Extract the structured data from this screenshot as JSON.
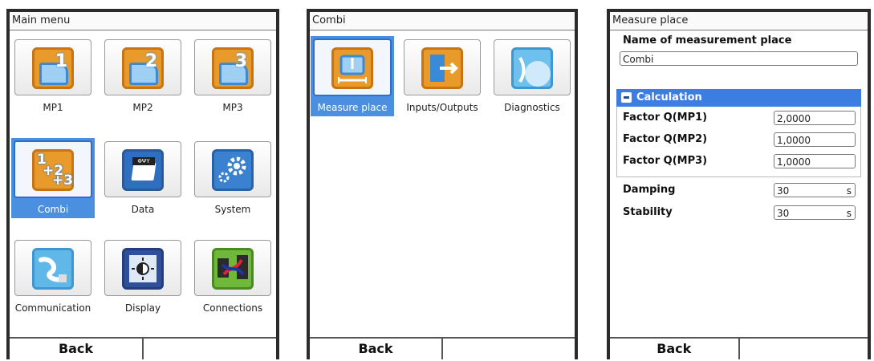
{
  "screens": [
    {
      "title": "Main menu",
      "tiles": [
        "MP1",
        "MP2",
        "MP3",
        "Combi",
        "Data",
        "System",
        "Communication",
        "Display",
        "Connections"
      ],
      "mp_numbers": [
        "1",
        "2",
        "3"
      ],
      "combi_digits": [
        "1",
        "+2",
        "+3"
      ],
      "softkeys": [
        "Back",
        ""
      ]
    },
    {
      "title": "Combi",
      "tiles": [
        "Measure place",
        "Inputs/Outputs",
        "Diagnostics"
      ],
      "softkeys": [
        "Back",
        ""
      ]
    },
    {
      "title": "Measure place",
      "name_label": "Name of measurement place",
      "name_value": "Combi",
      "section": "Calculation",
      "factors": [
        {
          "label": "Factor Q(MP1)",
          "value": "2,0000"
        },
        {
          "label": "Factor Q(MP2)",
          "value": "1,0000"
        },
        {
          "label": "Factor Q(MP3)",
          "value": "1,0000"
        }
      ],
      "damping": {
        "label": "Damping",
        "value": "30",
        "unit": "s"
      },
      "stability": {
        "label": "Stability",
        "value": "30",
        "unit": "s"
      },
      "softkeys": [
        "Back",
        ""
      ]
    }
  ],
  "colors": {
    "selection": "#4a8fe0",
    "section": "#3b7de0",
    "icon_orange": "#e89a2a"
  }
}
